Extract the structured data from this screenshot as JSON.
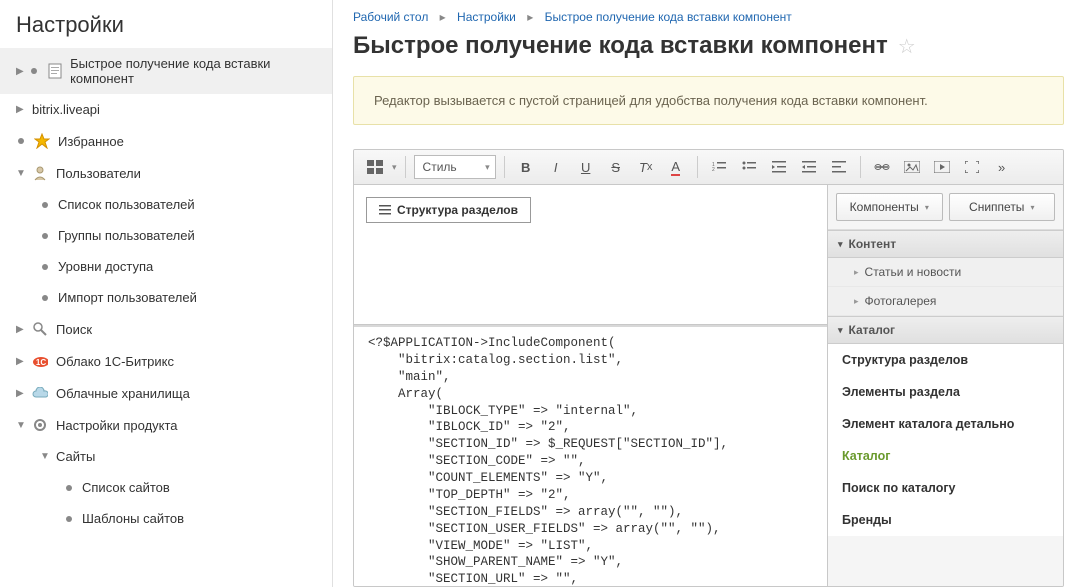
{
  "sidebar": {
    "title": "Настройки",
    "items": [
      {
        "label": "Быстрое получение кода вставки компонент",
        "icon": "page",
        "arrow": "▶",
        "level": 1,
        "active": true,
        "dot": true
      },
      {
        "label": "bitrix.liveapi",
        "arrow": "▶",
        "level": 1
      },
      {
        "label": "Избранное",
        "icon": "star",
        "level": 1,
        "dot": true
      },
      {
        "label": "Пользователи",
        "icon": "user",
        "arrow": "▼",
        "level": 1
      },
      {
        "label": "Список пользователей",
        "level": 2,
        "dot": true
      },
      {
        "label": "Группы пользователей",
        "level": 2,
        "dot": true
      },
      {
        "label": "Уровни доступа",
        "level": 2,
        "dot": true
      },
      {
        "label": "Импорт пользователей",
        "level": 2,
        "dot": true
      },
      {
        "label": "Поиск",
        "icon": "search",
        "arrow": "▶",
        "level": 1
      },
      {
        "label": "Облако 1С-Битрикс",
        "icon": "cloud-red",
        "arrow": "▶",
        "level": 1
      },
      {
        "label": "Облачные хранилища",
        "icon": "cloud",
        "arrow": "▶",
        "level": 1
      },
      {
        "label": "Настройки продукта",
        "icon": "gear",
        "arrow": "▼",
        "level": 1
      },
      {
        "label": "Сайты",
        "arrow": "▼",
        "level": 2
      },
      {
        "label": "Список сайтов",
        "level": 3,
        "dot": true
      },
      {
        "label": "Шаблоны сайтов",
        "level": 3,
        "dot": true
      }
    ]
  },
  "breadcrumb": [
    "Рабочий стол",
    "Настройки",
    "Быстрое получение кода вставки компонент"
  ],
  "page_title": "Быстрое получение кода вставки компонент",
  "notice": "Редактор вызывается с пустой страницей для удобства получения кода вставки компонент.",
  "toolbar": {
    "style_label": "Стиль"
  },
  "canvas": {
    "struct_btn": "Структура разделов"
  },
  "code": "<?$APPLICATION->IncludeComponent(\n    \"bitrix:catalog.section.list\",\n    \"main\",\n    Array(\n        \"IBLOCK_TYPE\" => \"internal\",\n        \"IBLOCK_ID\" => \"2\",\n        \"SECTION_ID\" => $_REQUEST[\"SECTION_ID\"],\n        \"SECTION_CODE\" => \"\",\n        \"COUNT_ELEMENTS\" => \"Y\",\n        \"TOP_DEPTH\" => \"2\",\n        \"SECTION_FIELDS\" => array(\"\", \"\"),\n        \"SECTION_USER_FIELDS\" => array(\"\", \"\"),\n        \"VIEW_MODE\" => \"LIST\",\n        \"SHOW_PARENT_NAME\" => \"Y\",\n        \"SECTION_URL\" => \"\",",
  "panel": {
    "btn_components": "Компоненты",
    "btn_snippets": "Сниппеты",
    "section_content": "Контент",
    "item_news": "Статьи и новости",
    "item_gallery": "Фотогалерея",
    "item_catalog": "Каталог",
    "links": [
      {
        "label": "Структура разделов"
      },
      {
        "label": "Элементы раздела"
      },
      {
        "label": "Элемент каталога детально"
      },
      {
        "label": "Каталог",
        "active": true
      },
      {
        "label": "Поиск по каталогу"
      },
      {
        "label": "Бренды"
      }
    ]
  }
}
